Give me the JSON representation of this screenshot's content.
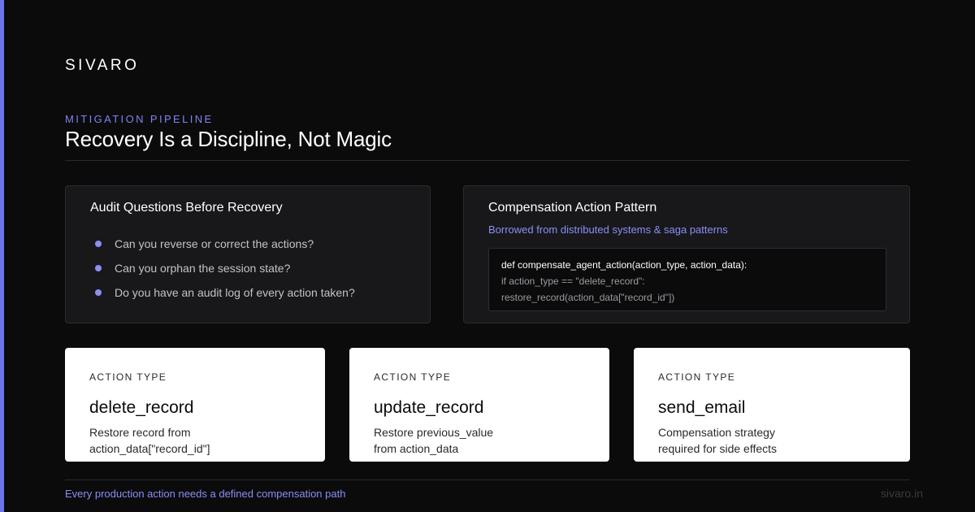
{
  "brand": {
    "name": "SIVARO",
    "domain": "sivaro.in"
  },
  "header": {
    "eyebrow": "MITIGATION PIPELINE",
    "title": "Recovery Is a Discipline, Not Magic"
  },
  "audit_panel": {
    "title": "Audit Questions Before Recovery",
    "items": [
      "Can you reverse or correct the actions?",
      "Can you orphan the session state?",
      "Do you have an audit log of every action taken?"
    ]
  },
  "compensation_panel": {
    "title": "Compensation Action Pattern",
    "subtitle": "Borrowed from distributed systems & saga patterns",
    "code_lines": [
      "def compensate_agent_action(action_type, action_data):",
      "if action_type == \"delete_record\":",
      "restore_record(action_data[\"record_id\"])"
    ]
  },
  "cards": [
    {
      "kicker": "ACTION TYPE",
      "title": "delete_record",
      "desc_line1": "Restore record from",
      "desc_line2": "action_data[\"record_id\"]"
    },
    {
      "kicker": "ACTION TYPE",
      "title": "update_record",
      "desc_line1": "Restore previous_value",
      "desc_line2": "from action_data"
    },
    {
      "kicker": "ACTION TYPE",
      "title": "send_email",
      "desc_line1": "Compensation strategy",
      "desc_line2": "required for side effects"
    }
  ],
  "footer": {
    "note": "Every production action needs a defined compensation path"
  },
  "colors": {
    "background": "#0b0b0c",
    "accent": "#6f73e8",
    "accent_text": "#8a8ef5",
    "panel": "#18181b",
    "card": "#ffffff"
  }
}
